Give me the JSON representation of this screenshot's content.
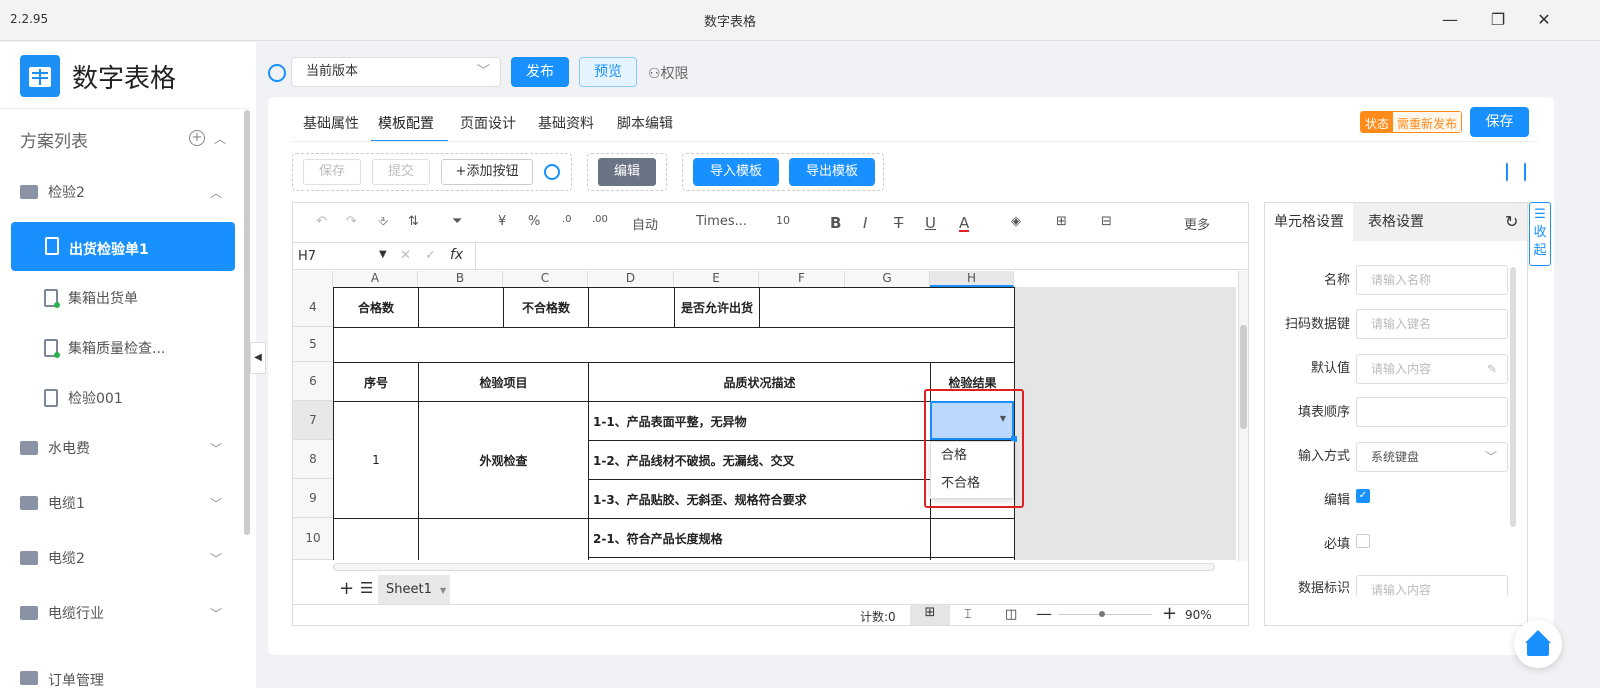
{
  "window": {
    "version": "2.2.95",
    "title": "数字表格",
    "minimize": "—",
    "restore": "❐",
    "close": "✕"
  },
  "sidebar": {
    "app_name": "数字表格",
    "list_title": "方案列表",
    "groups": [
      {
        "label": "检验2",
        "expanded": true,
        "children": [
          {
            "label": "出货检验单1",
            "active": true
          },
          {
            "label": "集箱出货单"
          },
          {
            "label": "集箱质量检查..."
          },
          {
            "label": "检验001"
          }
        ]
      },
      {
        "label": "水电费"
      },
      {
        "label": "电缆1"
      },
      {
        "label": "电缆2"
      },
      {
        "label": "电缆行业"
      },
      {
        "label": "订单管理"
      }
    ]
  },
  "topbar": {
    "version_select": "当前版本",
    "publish": "发布",
    "preview": "预览",
    "permission": "权限"
  },
  "tabs": [
    "基础属性",
    "模板配置",
    "页面设计",
    "基础资料",
    "脚本编辑"
  ],
  "active_tab": "模板配置",
  "status": {
    "label": "状态",
    "value": "需重新发布"
  },
  "save_button": "保存",
  "action_bar": {
    "save": "保存",
    "submit": "提交",
    "add_button": "+添加按钮",
    "edit": "编辑",
    "import": "导入模板",
    "export": "导出模板"
  },
  "toolbar": {
    "format_auto": "自动",
    "font": "Times...",
    "font_size": "10",
    "more": "更多",
    "currency": "¥",
    "percent": "%"
  },
  "formula_bar": {
    "cell_ref": "H7",
    "fx": "fx"
  },
  "columns": [
    "A",
    "B",
    "C",
    "D",
    "E",
    "F",
    "G",
    "H"
  ],
  "rows": [
    "4",
    "5",
    "6",
    "7",
    "8",
    "9",
    "10"
  ],
  "sheet": {
    "r4": {
      "a": "合格数",
      "c": "不合格数",
      "e": "是否允许出货"
    },
    "r6": {
      "a": "序号",
      "b": "检验项目",
      "d": "品质状况描述",
      "h": "检验结果"
    },
    "group1": {
      "num": "1",
      "item": "外观检查"
    },
    "r7d": "1-1、产品表面平整，无异物",
    "r8d": "1-2、产品线材不破损。无漏线、交叉",
    "r9d": "1-3、产品贴胶、无斜歪、规格符合要求",
    "r10d": "2-1、符合产品长度规格"
  },
  "dropdown": {
    "options": [
      "合格",
      "不合格"
    ]
  },
  "sheet_tabs": {
    "add": "+",
    "list": "☰",
    "name": "Sheet1"
  },
  "statusbar": {
    "count": "计数:0",
    "zoom": "90%"
  },
  "panel": {
    "tabs": [
      "单元格设置",
      "表格设置"
    ],
    "collapse": "收起",
    "fields": [
      {
        "label": "名称",
        "placeholder": "请输入名称"
      },
      {
        "label": "扫码数据键",
        "placeholder": "请输入键名"
      },
      {
        "label": "默认值",
        "placeholder": "请输入内容"
      },
      {
        "label": "填表顺序",
        "placeholder": ""
      },
      {
        "label": "输入方式",
        "value": "系统键盘"
      },
      {
        "label": "编辑",
        "checked": true
      },
      {
        "label": "必填",
        "checked": false
      },
      {
        "label": "数据标识",
        "placeholder": "请输入内容"
      }
    ]
  },
  "colors": {
    "primary": "#1890ff",
    "status_orange": "#ff8c1a",
    "highlight_red": "#e02020"
  }
}
